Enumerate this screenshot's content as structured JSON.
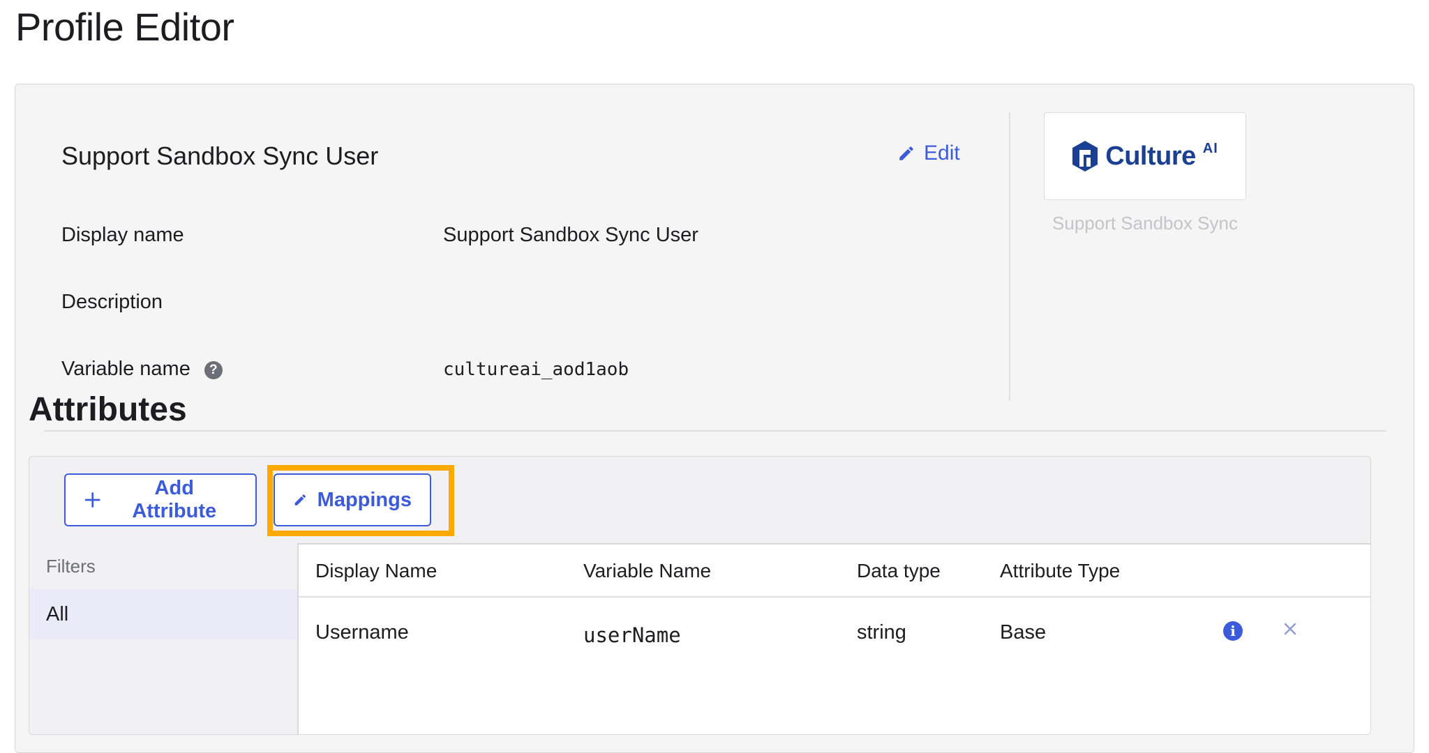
{
  "page": {
    "title": "Profile Editor"
  },
  "profile": {
    "name": "Support Sandbox Sync User",
    "edit_label": "Edit",
    "fields": {
      "display_name_label": "Display name",
      "display_name_value": "Support Sandbox Sync User",
      "description_label": "Description",
      "description_value": "",
      "variable_name_label": "Variable name",
      "variable_name_value": "cultureai_aod1aob",
      "help_icon_glyph": "?"
    },
    "logo": {
      "text": "Culture",
      "suffix": "AI",
      "caption": "Support Sandbox Sync"
    }
  },
  "attributes": {
    "title": "Attributes",
    "add_button_label": "Add Attribute",
    "mappings_button_label": "Mappings",
    "filters": {
      "title": "Filters",
      "items": [
        "All"
      ]
    },
    "columns": [
      "Display Name",
      "Variable Name",
      "Data type",
      "Attribute Type"
    ],
    "rows": [
      {
        "display_name": "Username",
        "variable_name": "userName",
        "data_type": "string",
        "attribute_type": "Base",
        "info_glyph": "i"
      }
    ]
  },
  "colors": {
    "accent": "#3b5bdb",
    "highlight": "#ffa800",
    "panel_bg": "#f5f5f6",
    "logo": "#1b3f92"
  },
  "icons": [
    "pencil-icon",
    "help-icon",
    "culture-logo-icon",
    "plus-icon",
    "info-icon",
    "close-icon"
  ]
}
